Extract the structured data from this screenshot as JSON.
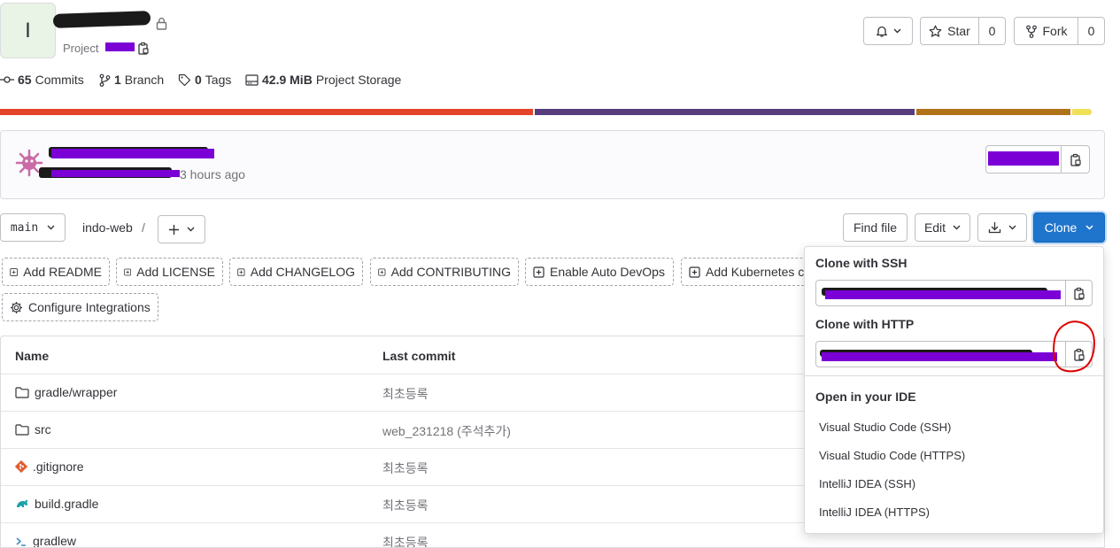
{
  "project": {
    "avatar_letter": "I",
    "subtitle_prefix": "Project",
    "stats": {
      "commits_count": "65",
      "commits_label": "Commits",
      "branch_count": "1",
      "branch_label": "Branch",
      "tags_count": "0",
      "tags_label": "Tags",
      "storage_size": "42.9 MiB",
      "storage_label": "Project Storage"
    }
  },
  "header_actions": {
    "star_label": "Star",
    "star_count": "0",
    "fork_label": "Fork",
    "fork_count": "0"
  },
  "language_bar": [
    {
      "color": "#e24329",
      "fraction": 0.485
    },
    {
      "color": "#563d7c",
      "fraction": 0.345
    },
    {
      "color": "#b07219",
      "fraction": 0.14
    },
    {
      "color": "#f1e05a",
      "fraction": 0.018
    }
  ],
  "last_commit": {
    "time_ago": "3 hours ago"
  },
  "repo_nav": {
    "branch": "main",
    "path": "indo-web",
    "separator": "/",
    "find_file": "Find file",
    "edit": "Edit",
    "clone": "Clone"
  },
  "quick_actions": [
    "Add README",
    "Add LICENSE",
    "Add CHANGELOG",
    "Add CONTRIBUTING",
    "Enable Auto DevOps",
    "Add Kubernetes c",
    "Configure Integrations"
  ],
  "file_table": {
    "headers": {
      "name": "Name",
      "last_commit": "Last commit"
    },
    "rows": [
      {
        "name": "gradle/wrapper",
        "icon": "folder-icon",
        "commit": "최초등록"
      },
      {
        "name": "src",
        "icon": "folder-icon",
        "commit": "web_231218 (주석추가)"
      },
      {
        "name": ".gitignore",
        "icon": "git-icon",
        "commit": "최초등록"
      },
      {
        "name": "build.gradle",
        "icon": "gradle-icon",
        "commit": "최초등록"
      },
      {
        "name": "gradlew",
        "icon": "terminal-icon",
        "commit": "최초등록"
      }
    ]
  },
  "clone_dropdown": {
    "ssh_title": "Clone with SSH",
    "http_title": "Clone with HTTP",
    "ide_title": "Open in your IDE",
    "ide_options": [
      "Visual Studio Code (SSH)",
      "Visual Studio Code (HTTPS)",
      "IntelliJ IDEA (SSH)",
      "IntelliJ IDEA (HTTPS)"
    ]
  },
  "colors": {
    "primary": "#1f75cb",
    "redaction": "#7b00d6",
    "annotation": "#e00000"
  }
}
